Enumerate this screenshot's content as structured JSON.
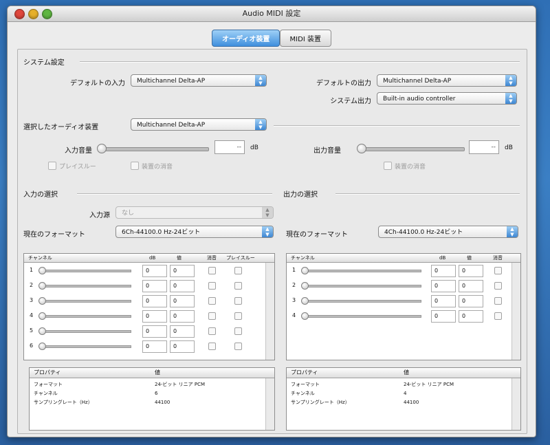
{
  "window": {
    "title": "Audio MIDI 設定"
  },
  "tabs": [
    {
      "label": "オーディオ装置",
      "active": true
    },
    {
      "label": "MIDI 装置",
      "active": false
    }
  ],
  "system": {
    "heading": "システム設定",
    "default_input_label": "デフォルトの入力",
    "default_input_value": "Multichannel Delta-AP",
    "default_output_label": "デフォルトの出力",
    "default_output_value": "Multichannel Delta-AP",
    "system_output_label": "システム出力",
    "system_output_value": "Built-in audio controller"
  },
  "device": {
    "label": "選択したオーディオ装置",
    "value": "Multichannel Delta-AP",
    "input_volume_label": "入力音量",
    "input_db_value": "--",
    "input_db_unit": "dB",
    "output_volume_label": "出力音量",
    "output_db_value": "--",
    "output_db_unit": "dB",
    "play_through_label": "プレイスルー",
    "input_mute_label": "装置の消音",
    "output_mute_label": "装置の消音"
  },
  "input": {
    "heading": "入力の選択",
    "source_label": "入力源",
    "source_value": "なし",
    "format_label": "現在のフォーマット",
    "format_value": "6Ch-44100.0 Hz-24ビット",
    "table_headers": [
      "チャンネル",
      "dB",
      "値",
      "消音",
      "プレイスルー"
    ],
    "channels": [
      {
        "num": "1",
        "db": "0",
        "val": "0"
      },
      {
        "num": "2",
        "db": "0",
        "val": "0"
      },
      {
        "num": "3",
        "db": "0",
        "val": "0"
      },
      {
        "num": "4",
        "db": "0",
        "val": "0"
      },
      {
        "num": "5",
        "db": "0",
        "val": "0"
      },
      {
        "num": "6",
        "db": "0",
        "val": "0"
      }
    ],
    "props_headers": [
      "プロパティ",
      "値"
    ],
    "props": [
      {
        "name": "フォーマット",
        "value": "24-ビット リニア PCM"
      },
      {
        "name": "チャンネル",
        "value": "6"
      },
      {
        "name": "サンプリングレート（Hz）",
        "value": "44100"
      }
    ]
  },
  "output": {
    "heading": "出力の選択",
    "format_label": "現在のフォーマット",
    "format_value": "4Ch-44100.0 Hz-24ビット",
    "table_headers": [
      "チャンネル",
      "dB",
      "値",
      "消音"
    ],
    "channels": [
      {
        "num": "1",
        "db": "0",
        "val": "0"
      },
      {
        "num": "2",
        "db": "0",
        "val": "0"
      },
      {
        "num": "3",
        "db": "0",
        "val": "0"
      },
      {
        "num": "4",
        "db": "0",
        "val": "0"
      }
    ],
    "props_headers": [
      "プロパティ",
      "値"
    ],
    "props": [
      {
        "name": "フォーマット",
        "value": "24-ビット リニア PCM"
      },
      {
        "name": "チャンネル",
        "value": "4"
      },
      {
        "name": "サンプリングレート（Hz）",
        "value": "44100"
      }
    ]
  },
  "colors": {
    "accent": "#3e87d3",
    "desktop": "#3b7fc4"
  },
  "icons": {
    "popup_arrow": "up-down-arrows-icon",
    "close": "close-button-icon"
  }
}
